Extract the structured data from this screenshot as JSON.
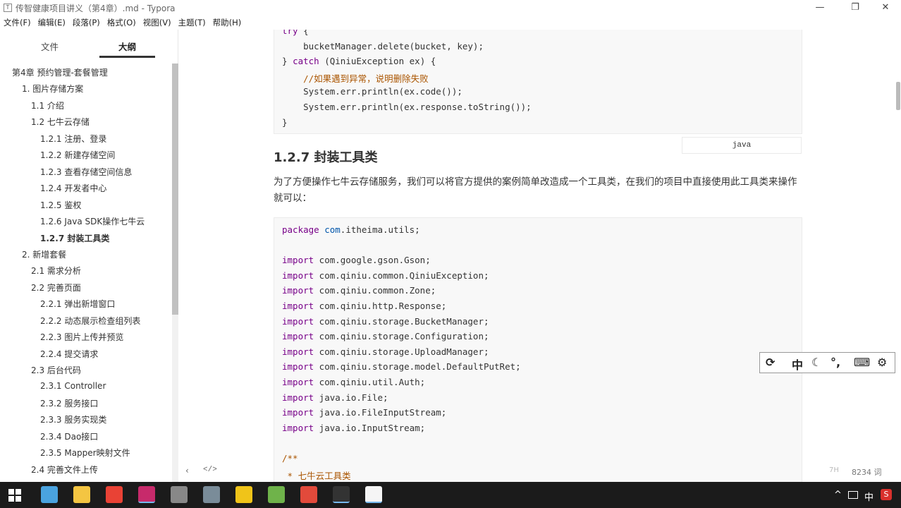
{
  "window": {
    "title": "传智健康项目讲义（第4章）.md - Typora",
    "app_icon": "T",
    "controls": {
      "minimize": "—",
      "restore": "❐",
      "close": "✕"
    }
  },
  "menu": [
    "文件(F)",
    "编辑(E)",
    "段落(P)",
    "格式(O)",
    "视图(V)",
    "主题(T)",
    "帮助(H)"
  ],
  "sidebar": {
    "tabs": [
      "文件",
      "大纲"
    ],
    "active_tab": "大纲",
    "outline": [
      {
        "label": "第4章 预约管理-套餐管理",
        "level": 0
      },
      {
        "label": "1. 图片存储方案",
        "level": 1
      },
      {
        "label": "1.1 介绍",
        "level": 2
      },
      {
        "label": "1.2 七牛云存储",
        "level": 2
      },
      {
        "label": "1.2.1 注册、登录",
        "level": 3
      },
      {
        "label": "1.2.2 新建存储空间",
        "level": 3
      },
      {
        "label": "1.2.3 查看存储空间信息",
        "level": 3
      },
      {
        "label": "1.2.4 开发者中心",
        "level": 3
      },
      {
        "label": "1.2.5 鉴权",
        "level": 3
      },
      {
        "label": "1.2.6 Java SDK操作七牛云",
        "level": 3
      },
      {
        "label": "1.2.7 封装工具类",
        "level": 3,
        "active": true
      },
      {
        "label": "2. 新增套餐",
        "level": 1
      },
      {
        "label": "2.1 需求分析",
        "level": 2
      },
      {
        "label": "2.2 完善页面",
        "level": 2
      },
      {
        "label": "2.2.1 弹出新增窗口",
        "level": 3
      },
      {
        "label": "2.2.2 动态展示检查组列表",
        "level": 3
      },
      {
        "label": "2.2.3 图片上传并预览",
        "level": 3
      },
      {
        "label": "2.2.4 提交请求",
        "level": 3
      },
      {
        "label": "2.3 后台代码",
        "level": 2
      },
      {
        "label": "2.3.1 Controller",
        "level": 3
      },
      {
        "label": "2.3.2 服务接口",
        "level": 3
      },
      {
        "label": "2.3.3 服务实现类",
        "level": 3
      },
      {
        "label": "2.3.4 Dao接口",
        "level": 3
      },
      {
        "label": "2.3.5 Mapper映射文件",
        "level": 3
      },
      {
        "label": "2.4 完善文件上传",
        "level": 2
      }
    ],
    "footer": {
      "back": "‹",
      "source_toggle": "</>"
    }
  },
  "editor": {
    "code1": [
      [
        {
          "t": "try",
          "c": "kw"
        },
        {
          "t": " {"
        }
      ],
      [
        {
          "t": "    bucketManager.delete(bucket, key);"
        }
      ],
      [
        {
          "t": "} "
        },
        {
          "t": "catch",
          "c": "kw"
        },
        {
          "t": " (QiniuException ex) {"
        }
      ],
      [
        {
          "t": "    //如果遇到异常，说明删除失败",
          "c": "cm"
        }
      ],
      [
        {
          "t": "    System.err.println(ex.code());"
        }
      ],
      [
        {
          "t": "    System.err.println(ex.response.toString());"
        }
      ],
      [
        {
          "t": "}"
        }
      ]
    ],
    "code1_lang": "java",
    "heading": "1.2.7 封装工具类",
    "paragraph": "为了方便操作七牛云存储服务，我们可以将官方提供的案例简单改造成一个工具类，在我们的项目中直接使用此工具类来操作就可以：",
    "code2": [
      [
        {
          "t": "package",
          "c": "kw"
        },
        {
          "t": " "
        },
        {
          "t": "com",
          "c": "pk"
        },
        {
          "t": ".itheima.utils;"
        }
      ],
      [],
      [
        {
          "t": "import",
          "c": "kw"
        },
        {
          "t": " com.google.gson.Gson;"
        }
      ],
      [
        {
          "t": "import",
          "c": "kw"
        },
        {
          "t": " com.qiniu.common.QiniuException;"
        }
      ],
      [
        {
          "t": "import",
          "c": "kw"
        },
        {
          "t": " com.qiniu.common.Zone;"
        }
      ],
      [
        {
          "t": "import",
          "c": "kw"
        },
        {
          "t": " com.qiniu.http.Response;"
        }
      ],
      [
        {
          "t": "import",
          "c": "kw"
        },
        {
          "t": " com.qiniu.storage.BucketManager;"
        }
      ],
      [
        {
          "t": "import",
          "c": "kw"
        },
        {
          "t": " com.qiniu.storage.Configuration;"
        }
      ],
      [
        {
          "t": "import",
          "c": "kw"
        },
        {
          "t": " com.qiniu.storage.UploadManager;"
        }
      ],
      [
        {
          "t": "import",
          "c": "kw"
        },
        {
          "t": " com.qiniu.storage.model.DefaultPutRet;"
        }
      ],
      [
        {
          "t": "import",
          "c": "kw"
        },
        {
          "t": " com.qiniu.util.Auth;"
        }
      ],
      [
        {
          "t": "import",
          "c": "kw"
        },
        {
          "t": " java.io.File;"
        }
      ],
      [
        {
          "t": "import",
          "c": "kw"
        },
        {
          "t": " java.io.FileInputStream;"
        }
      ],
      [
        {
          "t": "import",
          "c": "kw"
        },
        {
          "t": " java.io.InputStream;"
        }
      ],
      [],
      [
        {
          "t": "/**",
          "c": "cm"
        }
      ],
      [
        {
          "t": " * 七牛云工具类",
          "c": "cm"
        }
      ]
    ]
  },
  "status": {
    "word_count": "8234 词",
    "extra": "7H"
  },
  "ime": {
    "items": [
      "⟳",
      "中",
      "☾",
      "°,",
      "⌨",
      "⚙"
    ]
  },
  "taskbar": {
    "apps": [
      {
        "name": "explorer-icon",
        "color": "#4aa3df"
      },
      {
        "name": "folder-icon",
        "color": "#f4c542"
      },
      {
        "name": "chrome-icon",
        "color": "#e94235"
      },
      {
        "name": "intellij-icon",
        "color": "#c72a6b"
      },
      {
        "name": "app-icon",
        "color": "#888888"
      },
      {
        "name": "calculator-icon",
        "color": "#7a8c99"
      },
      {
        "name": "chat-icon",
        "color": "#f0c419"
      },
      {
        "name": "notepad-icon",
        "color": "#6fb34a"
      },
      {
        "name": "paint-icon",
        "color": "#e24a3b"
      },
      {
        "name": "terminal-icon",
        "color": "#333333"
      },
      {
        "name": "typora-icon",
        "color": "#f5f5f5"
      }
    ],
    "tray": {
      "chevron": "^",
      "ime": "中",
      "sougou": "S"
    }
  }
}
